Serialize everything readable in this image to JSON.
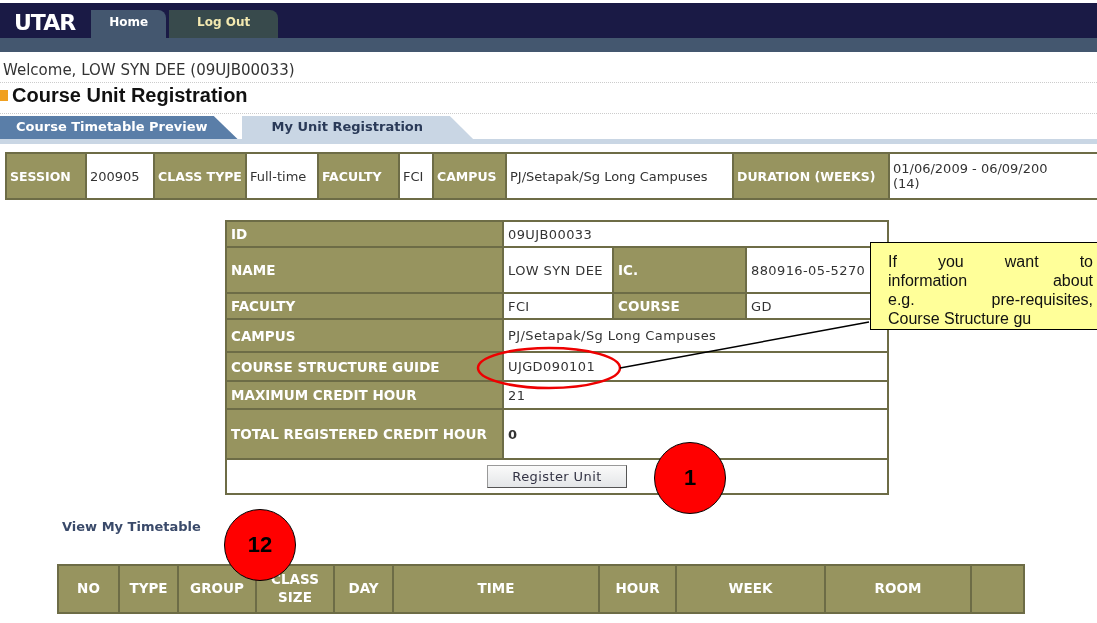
{
  "header": {
    "logo": "UTAR",
    "nav_tabs": [
      {
        "label": "Home",
        "selected": true
      },
      {
        "label": "Log Out",
        "selected": false
      }
    ]
  },
  "welcome": "Welcome, LOW SYN DEE (09UJB00033)",
  "page_title": "Course Unit Registration",
  "sub_tabs": [
    {
      "label": "Course Timetable Preview",
      "selected": false
    },
    {
      "label": "My Unit Registration",
      "selected": true
    }
  ],
  "session_info": [
    {
      "label": "SESSION",
      "value": "200905"
    },
    {
      "label": "CLASS TYPE",
      "value": "Full-time"
    },
    {
      "label": "FACULTY",
      "value": "FCI"
    },
    {
      "label": "CAMPUS",
      "value": "PJ/Setapak/Sg Long Campuses"
    },
    {
      "label": "DURATION (WEEKS)",
      "value": "01/06/2009 - 06/09/200\n(14)"
    }
  ],
  "student": {
    "rows": [
      [
        {
          "label": "ID",
          "value": "09UJB00033"
        }
      ],
      [
        {
          "label": "NAME",
          "value": "LOW SYN DEE"
        },
        {
          "label": "IC.",
          "value": "880916-05-5270"
        }
      ],
      [
        {
          "label": "FACULTY",
          "value": "FCI"
        },
        {
          "label": "COURSE",
          "value": "GD"
        }
      ],
      [
        {
          "label": "CAMPUS",
          "value": "PJ/Setapak/Sg Long Campuses"
        }
      ],
      [
        {
          "label": "COURSE STRUCTURE GUIDE",
          "value": "UJGD090101"
        }
      ],
      [
        {
          "label": "MAXIMUM CREDIT HOUR",
          "value": "21"
        }
      ],
      [
        {
          "label": "TOTAL REGISTERED CREDIT HOUR",
          "value": "0"
        }
      ]
    ],
    "button": "Register Unit"
  },
  "timetable_link": "View My Timetable",
  "timetable": {
    "columns": [
      "NO",
      "TYPE",
      "GROUP",
      "CLASS SIZE",
      "DAY",
      "TIME",
      "HOUR",
      "WEEK",
      "ROOM"
    ]
  },
  "callout": {
    "lines": [
      "If you want to",
      "information about",
      "e.g. pre-requisites,",
      "Course Structure gu"
    ]
  },
  "step_markers": [
    {
      "label": "1"
    },
    {
      "label": "12"
    }
  ]
}
